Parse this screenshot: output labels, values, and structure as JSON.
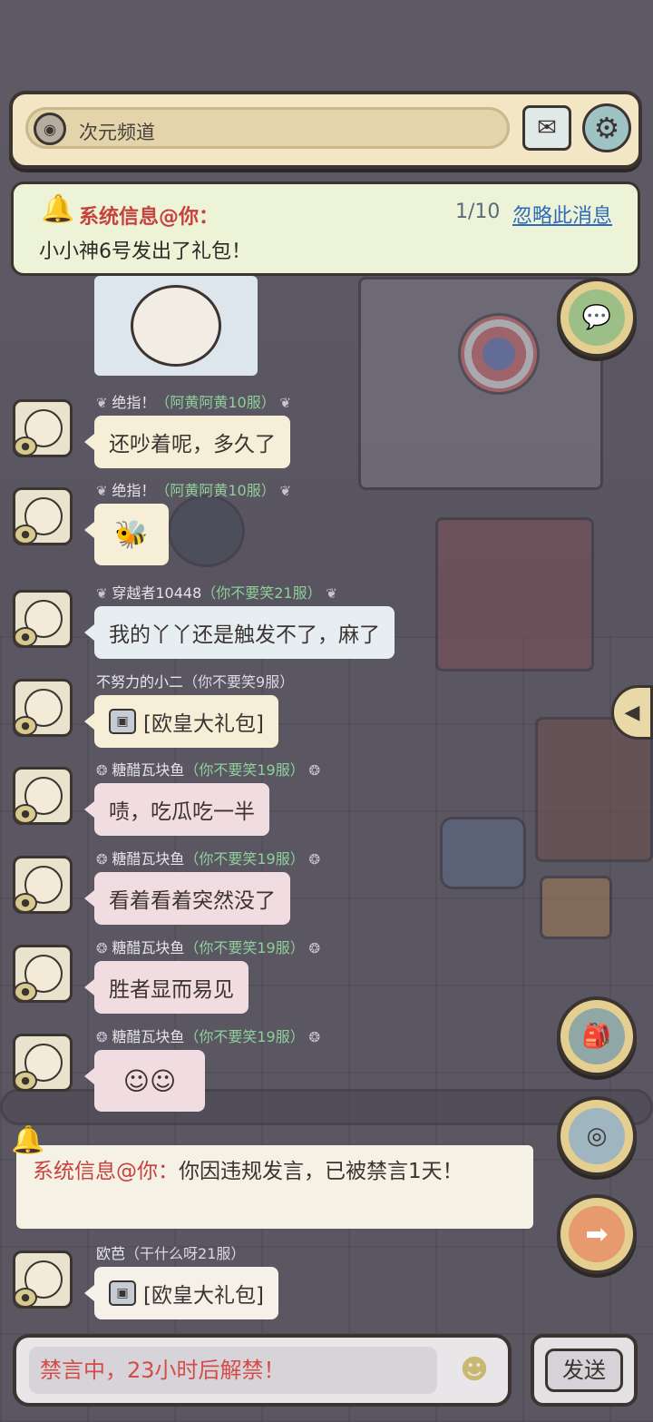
{
  "header": {
    "channel_name": "次元频道",
    "channel_icon": "portal-icon",
    "mail_icon": "mail-icon",
    "settings_icon": "gear-icon"
  },
  "notice": {
    "title": "系统信息@你：",
    "counter": "1/10",
    "ignore_label": "忽略此消息",
    "body": "小小神6号发出了礼包！"
  },
  "messages": [
    {
      "sender": "绝指！",
      "server": "（阿黄阿黄10服）",
      "text": "还吵着呢，多久了",
      "style": "cream"
    },
    {
      "sender": "绝指！",
      "server": "（阿黄阿黄10服）",
      "sticker": "bee-sticker"
    },
    {
      "sender": "穿越者10448",
      "server": "（你不要笑21服）",
      "text": "我的丫丫还是触发不了，麻了",
      "style": "blue"
    },
    {
      "sender": "不努力的小二",
      "server": "（你不要笑9服）",
      "text": "[欧皇大礼包]",
      "style": "cream",
      "gift": true
    },
    {
      "sender": "糖醋瓦块鱼",
      "server": "（你不要笑19服）",
      "text": "啧，吃瓜吃一半",
      "style": "pink"
    },
    {
      "sender": "糖醋瓦块鱼",
      "server": "（你不要笑19服）",
      "text": "看着看着突然没了",
      "style": "pink"
    },
    {
      "sender": "糖醋瓦块鱼",
      "server": "（你不要笑19服）",
      "text": "胜者显而易见",
      "style": "pink"
    },
    {
      "sender": "糖醋瓦块鱼",
      "server": "（你不要笑19服）",
      "sticker": "face-emoji-sticker"
    },
    {
      "sender": "欧芭",
      "server": "（干什么呀21服）",
      "text": "[欧皇大礼包]",
      "style": "white",
      "gift": true
    }
  ],
  "system_message": {
    "label": "系统信息@你：",
    "text": "你因违规发言，已被禁言1天！"
  },
  "side_buttons": {
    "chat_icon": "chat-bubbles-icon",
    "bag_icon": "backpack-icon",
    "portal_icon": "portal-icon",
    "next_icon": "arrow-right-icon",
    "expand_icon": "triangle-left-icon"
  },
  "input": {
    "muted_text": "禁言中，23小时后解禁！",
    "emoji_icon": "emoji-icon",
    "send_label": "发送"
  }
}
